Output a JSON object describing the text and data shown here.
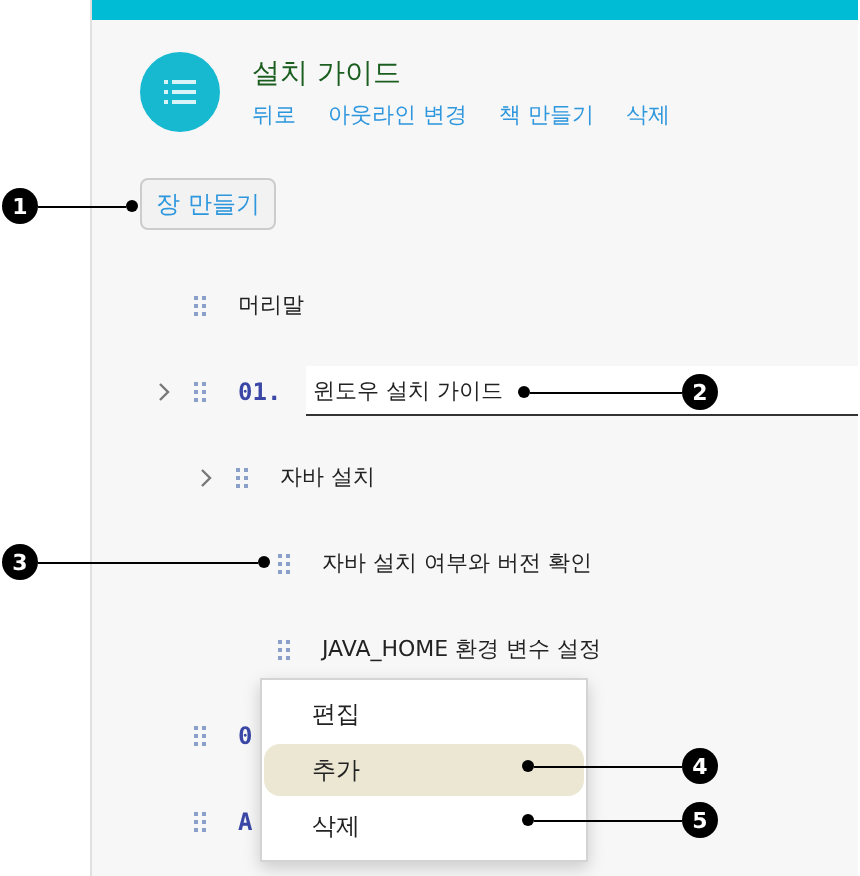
{
  "header": {
    "title": "설치 가이드",
    "links": [
      "뒤로",
      "아웃라인 변경",
      "책 만들기",
      "삭제"
    ]
  },
  "create_chapter_button": "장 만들기",
  "outline": [
    {
      "title": "머리말",
      "collapsible": false,
      "editing": false
    },
    {
      "number": "01.",
      "title": "윈도우 설치 가이드",
      "collapsible": true,
      "editing": true,
      "children": [
        {
          "title": "자바 설치",
          "collapsible": true,
          "editing": false,
          "children": [
            {
              "title": "자바 설치 여부와 버전 확인",
              "collapsible": false,
              "editing": false
            },
            {
              "title": "JAVA_HOME 환경 변수 설정",
              "collapsible": false,
              "editing": false
            }
          ]
        }
      ]
    },
    {
      "number": "0",
      "collapsible": false
    },
    {
      "number": "A",
      "collapsible": false
    }
  ],
  "context_menu": [
    {
      "label": "편집",
      "selected": false
    },
    {
      "label": "추가",
      "selected": true
    },
    {
      "label": "삭제",
      "selected": false
    }
  ],
  "callouts": [
    "1",
    "2",
    "3",
    "4",
    "5"
  ]
}
